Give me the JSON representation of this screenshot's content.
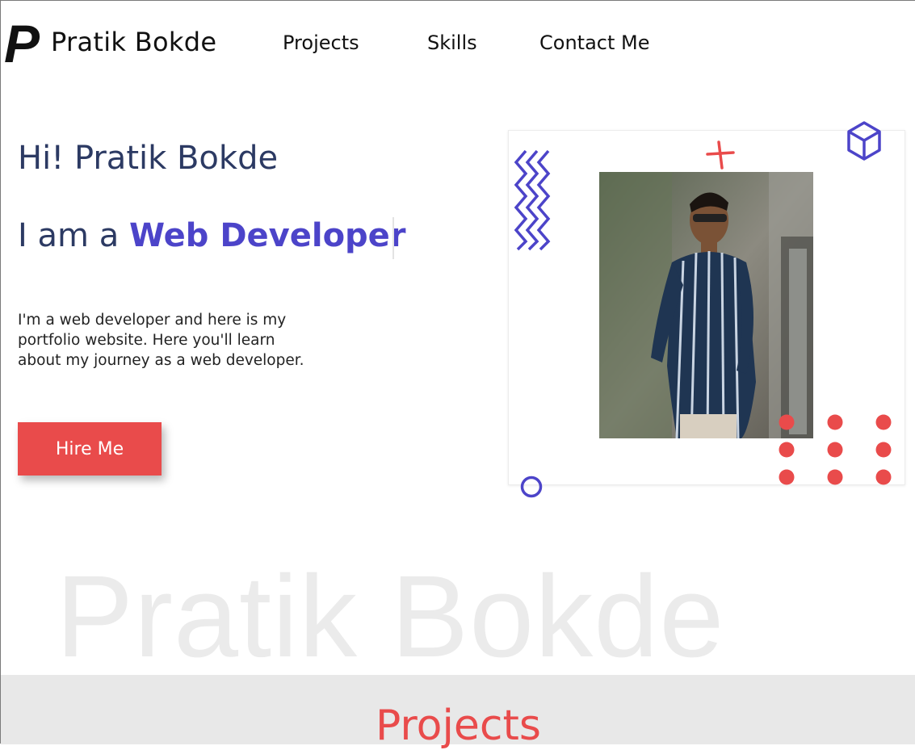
{
  "brand": {
    "name": "Pratik Bokde",
    "logo_letter": "P"
  },
  "nav": {
    "items": [
      "Projects",
      "Skills",
      "Contact Me"
    ]
  },
  "hero": {
    "greeting": "Hi! Pratik Bokde",
    "role_prefix": "I am a ",
    "role_highlight": "Web Developer",
    "description": "I'm a web developer and here is my portfolio website. Here you'll learn about my journey as a web developer.",
    "cta_label": "Hire Me"
  },
  "watermark": "Pratik Bokde",
  "projects_section": {
    "title": "Projects"
  },
  "colors": {
    "accent_red": "#e94b4b",
    "accent_purple": "#4c44c9",
    "heading_navy": "#2c3a63"
  },
  "icons": [
    "logo-p-icon",
    "zigzag-icon",
    "plus-icon",
    "cube-icon",
    "circle-icon",
    "dot-grid-icon"
  ]
}
